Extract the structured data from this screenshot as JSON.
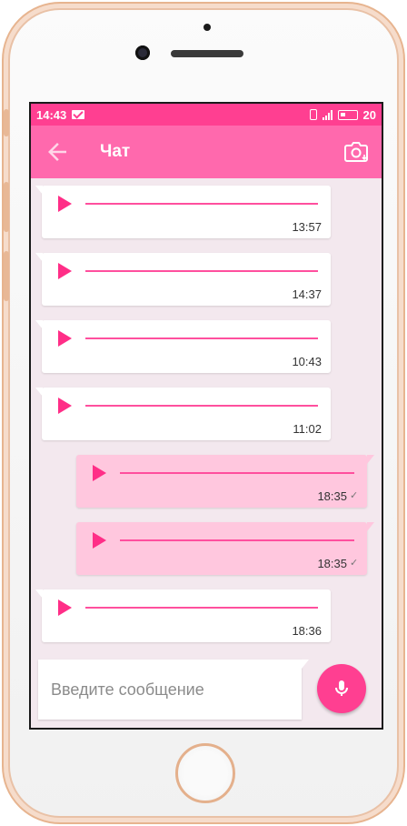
{
  "status_bar": {
    "time": "14:43",
    "battery": "20"
  },
  "header": {
    "title": "Чат"
  },
  "messages": [
    {
      "direction": "in",
      "time": "13:57"
    },
    {
      "direction": "in",
      "time": "14:37"
    },
    {
      "direction": "in",
      "time": "10:43"
    },
    {
      "direction": "in",
      "time": "11:02"
    },
    {
      "direction": "out",
      "time": "18:35",
      "status": "sent"
    },
    {
      "direction": "out",
      "time": "18:35",
      "status": "sent"
    },
    {
      "direction": "in",
      "time": "18:36"
    }
  ],
  "composer": {
    "placeholder": "Введите сообщение",
    "value": ""
  },
  "colors": {
    "status_bar": "#ff3f91",
    "app_bar": "#ff69ad",
    "incoming_bubble": "#ffffff",
    "outgoing_bubble": "#ffc7de",
    "accent": "#ff2e87"
  },
  "icons": [
    "back-arrow-icon",
    "camera-switch-icon",
    "play-icon",
    "check-icon",
    "microphone-icon"
  ]
}
